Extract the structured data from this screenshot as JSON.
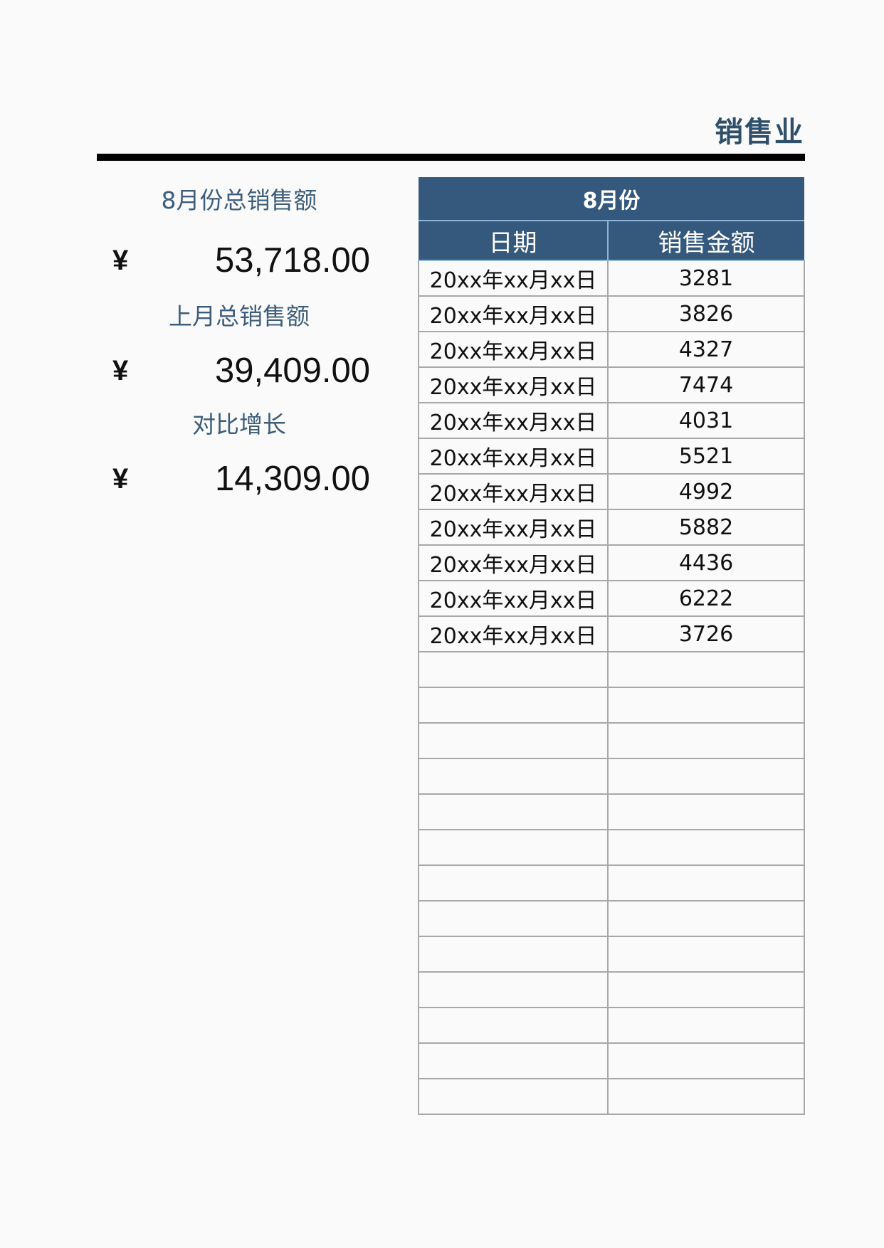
{
  "document": {
    "title": "销售业"
  },
  "summary": {
    "current_label": "8月份总销售额",
    "current_currency": "¥",
    "current_value": "53,718.00",
    "previous_label": "上月总销售额",
    "previous_currency": "¥",
    "previous_value": "39,409.00",
    "growth_label": "对比增长",
    "growth_currency": "¥",
    "growth_value": "14,309.00"
  },
  "table": {
    "month_header": "8月份",
    "columns": [
      "日期",
      "销售金额"
    ],
    "rows": [
      [
        "20xx年xx月xx日",
        "3281"
      ],
      [
        "20xx年xx月xx日",
        "3826"
      ],
      [
        "20xx年xx月xx日",
        "4327"
      ],
      [
        "20xx年xx月xx日",
        "7474"
      ],
      [
        "20xx年xx月xx日",
        "4031"
      ],
      [
        "20xx年xx月xx日",
        "5521"
      ],
      [
        "20xx年xx月xx日",
        "4992"
      ],
      [
        "20xx年xx月xx日",
        "5882"
      ],
      [
        "20xx年xx月xx日",
        "4436"
      ],
      [
        "20xx年xx月xx日",
        "6222"
      ],
      [
        "20xx年xx月xx日",
        "3726"
      ],
      [
        "",
        ""
      ],
      [
        "",
        ""
      ],
      [
        "",
        ""
      ],
      [
        "",
        ""
      ],
      [
        "",
        ""
      ],
      [
        "",
        ""
      ],
      [
        "",
        ""
      ],
      [
        "",
        ""
      ],
      [
        "",
        ""
      ],
      [
        "",
        ""
      ],
      [
        "",
        ""
      ],
      [
        "",
        ""
      ],
      [
        "",
        ""
      ]
    ]
  },
  "colors": {
    "header_bg": "#34597c",
    "title_text": "#2f4f6a",
    "label_text": "#3e5d7a",
    "grid": "#a8a8a8"
  }
}
